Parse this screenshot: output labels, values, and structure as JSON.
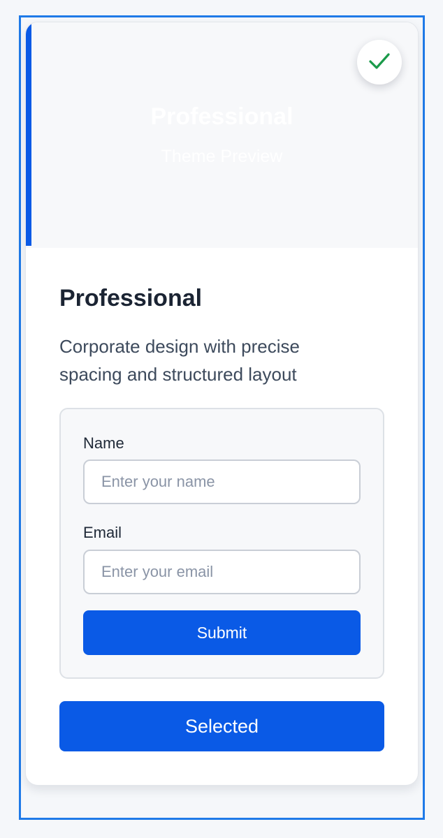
{
  "colors": {
    "accent": "#0a5ae6",
    "frame": "#1f7ae8",
    "check": "#1a9a4a"
  },
  "preview": {
    "title": "Professional",
    "subtitle": "Theme Preview",
    "badge_icon": "check-icon"
  },
  "theme": {
    "name": "Professional",
    "description": "Corporate design with precise spacing and structured layout"
  },
  "form": {
    "name_label": "Name",
    "name_placeholder": "Enter your name",
    "email_label": "Email",
    "email_placeholder": "Enter your email",
    "submit_label": "Submit"
  },
  "select_button": {
    "label": "Selected"
  }
}
